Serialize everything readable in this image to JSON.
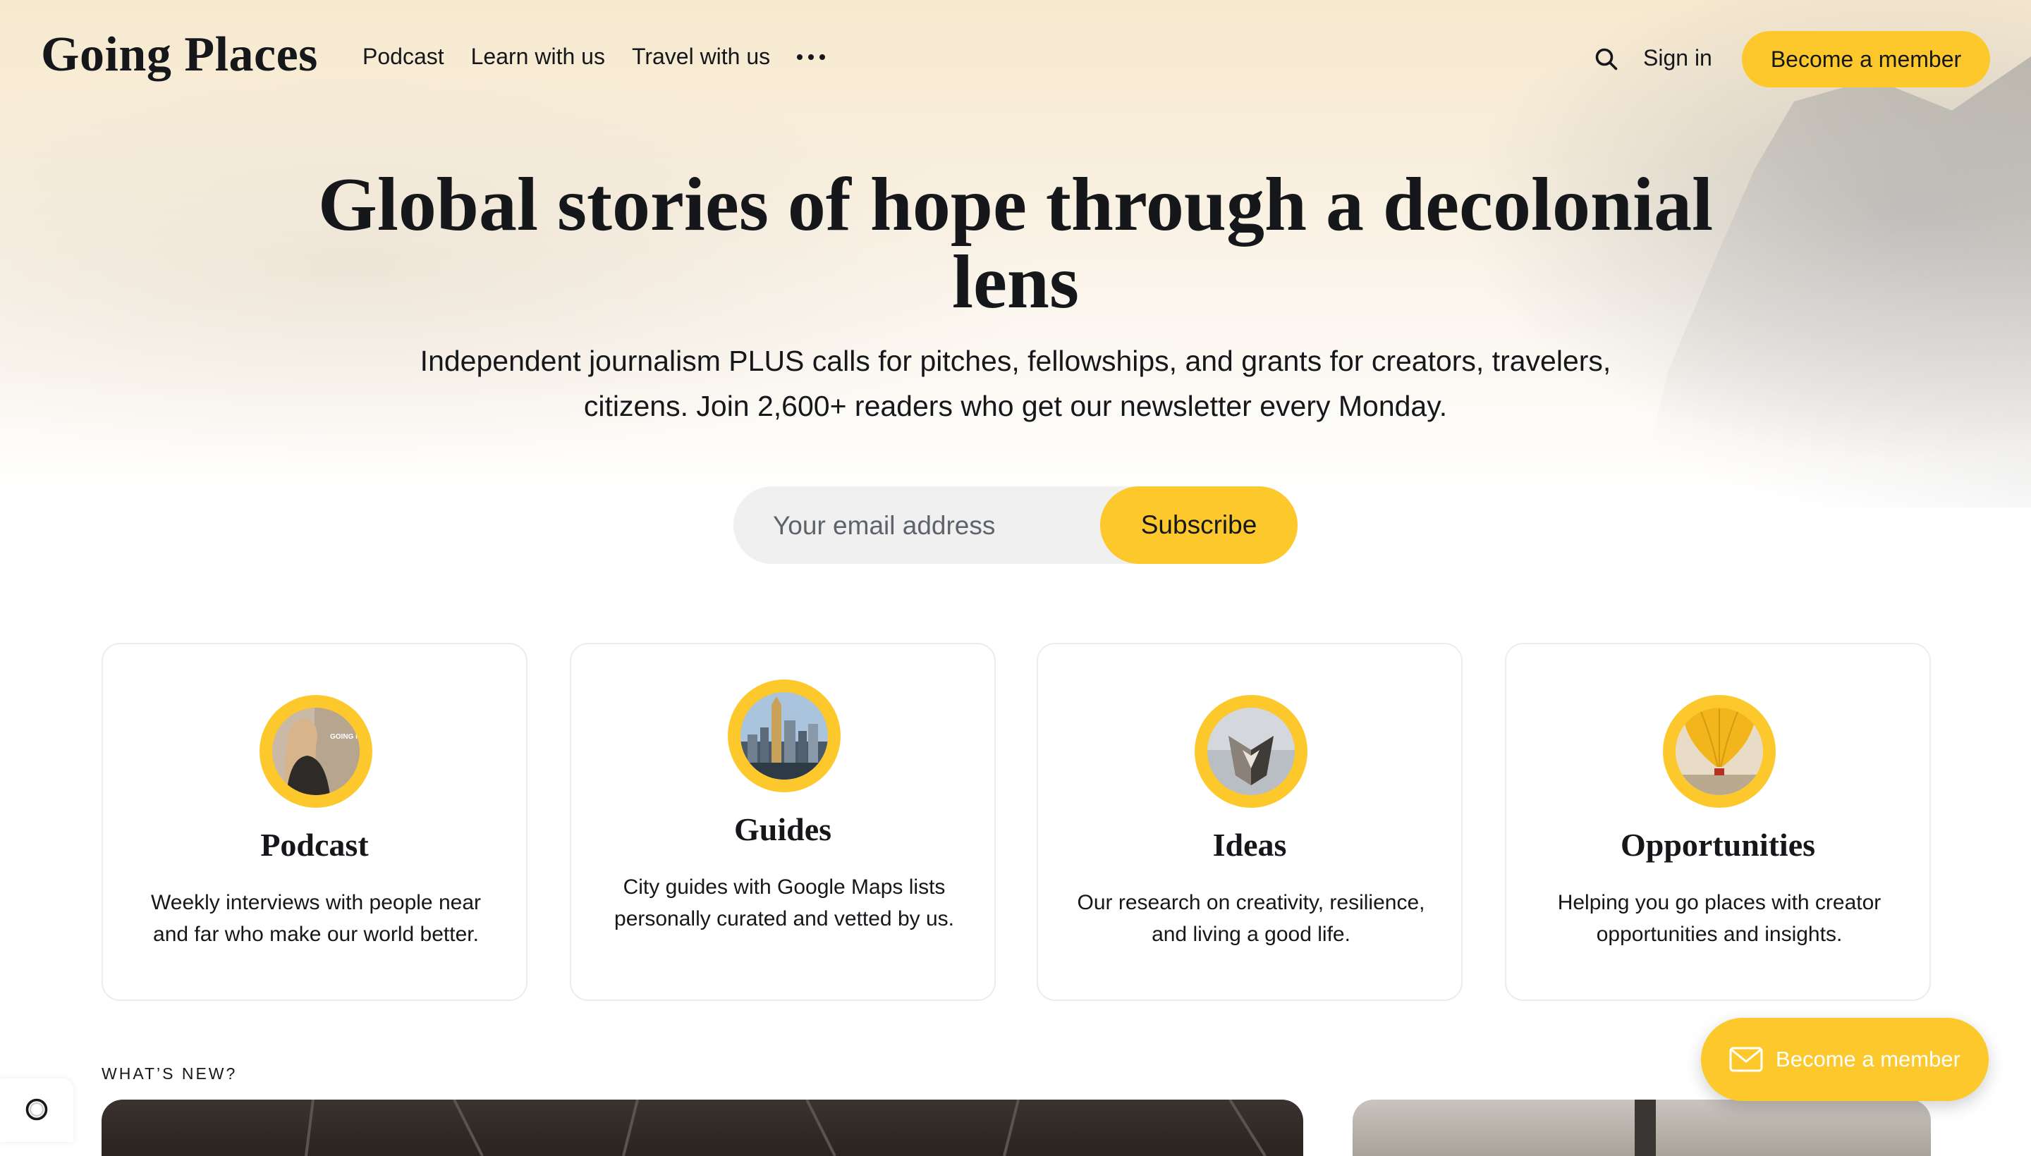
{
  "brand": {
    "logo": "Going Places",
    "accent_color": "#fcc82c"
  },
  "nav": {
    "items": [
      {
        "label": "Podcast"
      },
      {
        "label": "Learn with us"
      },
      {
        "label": "Travel with us"
      }
    ],
    "more_icon": "more-dots-icon",
    "search_icon": "search-icon",
    "sign_in": "Sign in",
    "member_button": "Become a member"
  },
  "hero": {
    "headline": "Global stories of hope through a decolonial lens",
    "subtitle": "Independent journalism PLUS calls for pitches, fellowships, and grants for creators, travelers, citizens. Join 2,600+ readers who get our newsletter every Monday.",
    "email_placeholder": "Your email address",
    "subscribe_label": "Subscribe"
  },
  "cards": [
    {
      "title": "Podcast",
      "description": "Weekly interviews with people near and far who make our world better.",
      "image": "podcast-cover"
    },
    {
      "title": "Guides",
      "description": "City guides with Google Maps lists personally curated and vetted by us.",
      "image": "city-skyline"
    },
    {
      "title": "Ideas",
      "description": "Our research on creativity, resilience, and living a good life.",
      "image": "geometric-sculpture"
    },
    {
      "title": "Opportunities",
      "description": "Helping you go places with creator opportunities and insights.",
      "image": "hot-air-balloon"
    }
  ],
  "whats_new": {
    "label": "WHAT’S NEW?"
  },
  "floating": {
    "label": "Become a member",
    "icon": "mail-icon"
  },
  "portal": {
    "icon": "portal-trigger-icon"
  },
  "podcast_cover_text": "GOING PLACES"
}
